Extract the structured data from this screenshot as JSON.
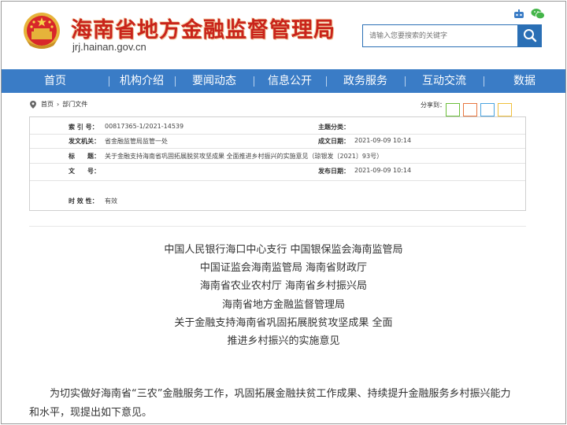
{
  "header": {
    "site_title": "海南省地方金融监督管理局",
    "site_url": "jrj.hainan.gov.cn",
    "search_placeholder": "请输入您要搜索的关键字"
  },
  "nav": {
    "items": [
      "首页",
      "机构介绍",
      "要闻动态",
      "信息公开",
      "政务服务",
      "互动交流",
      "数据"
    ]
  },
  "breadcrumb": {
    "items": [
      "首页",
      "›",
      "部门文件"
    ],
    "share_label": "分享到："
  },
  "share_colors": [
    "#6cbf3a",
    "#e8763f",
    "#4aa3df",
    "#f0c03c"
  ],
  "info": {
    "index_label": "索 引 号：",
    "index_value": "00817365-1/2021-14539",
    "topic_label": "主题分类：",
    "topic_value": "",
    "issuer_label": "发文机关：",
    "issuer_value": "省金融监管局监管一处",
    "created_label": "成文日期：",
    "created_value": "2021-09-09 10:14",
    "title_label": "标　　题：",
    "title_value": "关于金融支持海南省巩固拓展脱贫攻坚成果 全面推进乡村振兴的实施意见（琼银发〔2021〕93号）",
    "docno_label": "文　　号：",
    "docno_value": "",
    "published_label": "发布日期：",
    "published_value": "2021-09-09 10:14",
    "validity_label": "时 效 性：",
    "validity_value": "有效"
  },
  "article": {
    "heading_lines": [
      "中国人民银行海口中心支行  中国银保监会海南监管局",
      "中国证监会海南监管局 海南省财政厅",
      "海南省农业农村厅 海南省乡村振兴局",
      "海南省地方金融监督管理局",
      "关于金融支持海南省巩固拓展脱贫攻坚成果 全面",
      "推进乡村振兴的实施意见"
    ],
    "paragraph_line1": "为切实做好海南省“三农”金融服务工作，巩固拓展金融扶贫工作成果、持续提升金融服务乡村振兴能力",
    "paragraph_line2": "和水平，现提出如下意见。"
  }
}
